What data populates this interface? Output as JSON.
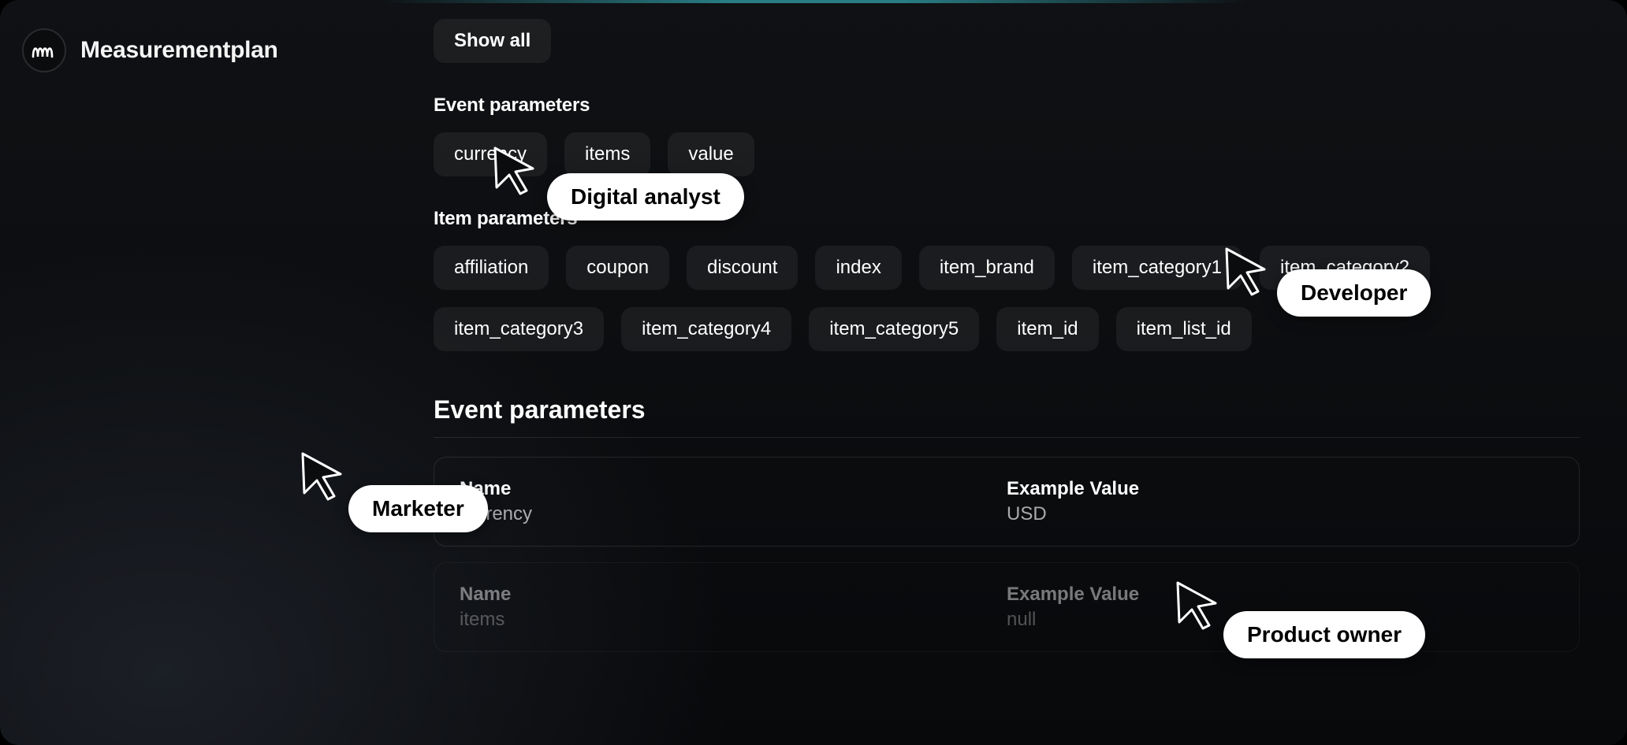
{
  "brand": "Measurementplan",
  "show_all_label": "Show all",
  "sections": {
    "event_params_label": "Event parameters",
    "item_params_label": "Item parameters",
    "event_params_title": "Event parameters"
  },
  "event_param_chips": [
    "currency",
    "items",
    "value"
  ],
  "item_param_chips": [
    "affiliation",
    "coupon",
    "discount",
    "index",
    "item_brand",
    "item_category1",
    "item_category2",
    "item_category3",
    "item_category4",
    "item_category5",
    "item_id",
    "item_list_id"
  ],
  "table": {
    "name_label": "Name",
    "example_label": "Example Value",
    "rows": [
      {
        "name": "currency",
        "example": "USD"
      },
      {
        "name": "items",
        "example": "null"
      }
    ]
  },
  "cursors": {
    "analyst": "Digital analyst",
    "marketer": "Marketer",
    "developer": "Developer",
    "product_owner": "Product owner"
  }
}
